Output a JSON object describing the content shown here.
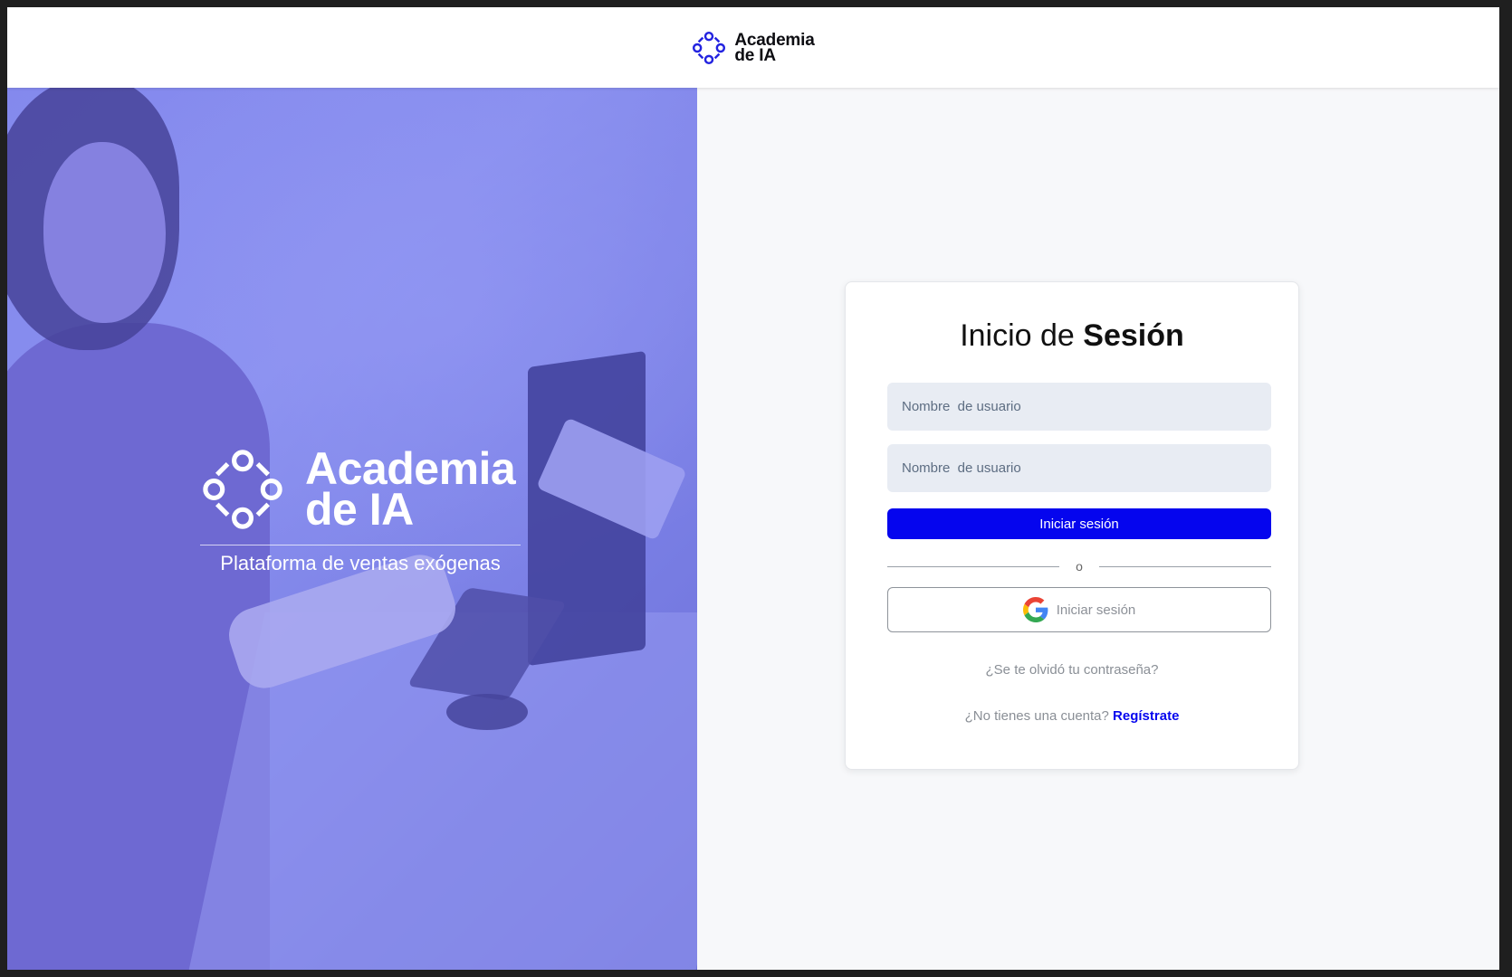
{
  "header": {
    "brand_line1": "Academia",
    "brand_line2": "de IA"
  },
  "hero": {
    "brand_line1": "Academia",
    "brand_line2": "de IA",
    "subtitle": "Plataforma de ventas exógenas"
  },
  "login": {
    "title_light": "Inicio de ",
    "title_bold": "Sesión",
    "username_placeholder": "Nombre  de usuario",
    "password_placeholder": "Nombre  de usuario",
    "submit_label": "Iniciar sesión",
    "separator": "o",
    "google_label": "Iniciar sesión",
    "forgot_password": "¿Se te olvidó tu contraseña?",
    "register_prompt": "¿No tienes una cuenta?",
    "register_link": "Regístrate"
  },
  "colors": {
    "accent": "#0505ee",
    "hero_tint": "#8a8ff0",
    "panel_bg": "#f7f8fa",
    "input_bg": "#e8ecf3"
  },
  "icons": {
    "brand": "academia-logo-icon",
    "google": "google-icon"
  }
}
